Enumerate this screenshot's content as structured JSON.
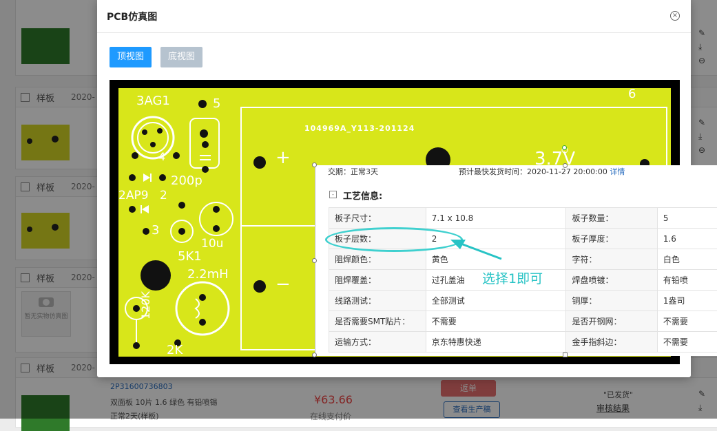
{
  "background": {
    "orders": [
      {
        "label": "样板",
        "date": "2020-"
      },
      {
        "label": "样板",
        "date": "2020-"
      },
      {
        "label": "样板",
        "date": "2020-"
      },
      {
        "label": "样板",
        "date": "2020-"
      }
    ],
    "no_photo_text": "暂无实物仿真图",
    "last_order": {
      "order_no": "2P31600736803",
      "spec": "双面板   10片   1.6   绿色   有铅喷锡",
      "spec2": "正常2天(样板)",
      "price": "¥63.66",
      "payment": "在线支付价",
      "return_label": "返单",
      "production_label": "查看生产稿",
      "ship_status": "\"已发货\"",
      "audit_label": "审核结果"
    },
    "side_icons": [
      "edit-icon",
      "download-icon",
      "more-icon"
    ]
  },
  "modal": {
    "title": "PCB仿真图",
    "close_label": "×",
    "tabs": {
      "top": "顶视图",
      "bottom": "底视图"
    }
  },
  "pcb": {
    "board_id": "104969A_Y113-201124",
    "labels": {
      "fuse": "3AG1",
      "pin5": "5",
      "pin6": "6",
      "pin4": "4",
      "pin3": "3",
      "cap": "200p",
      "diode": "2AP9",
      "pin2": "2",
      "plus": "+",
      "minus": "−",
      "cap2": "10u",
      "res": "5K1",
      "ind": "2.2mH",
      "res2": "120K",
      "res3": "2K",
      "volt": "3.7V"
    }
  },
  "pasted": {
    "delivery": "交期：正常3天",
    "estimate_label": "预计最快发货时间：2020-11-27 20:00:00",
    "estimate_link": "详情",
    "section_toggle": "-",
    "section_title": "工艺信息:",
    "rows": [
      [
        "板子尺寸：",
        "7.1 x 10.8",
        "板子数量：",
        "5"
      ],
      [
        "板子层数：",
        "2",
        "板子厚度：",
        "1.6"
      ],
      [
        "阻焊颜色：",
        "黄色",
        "字符：",
        "白色"
      ],
      [
        "阻焊覆盖：",
        "过孔盖油",
        "焊盘喷镀：",
        "有铅喷"
      ],
      [
        "线路测试：",
        "全部测试",
        "铜厚：",
        "1盎司"
      ],
      [
        "是否需要SMT贴片：",
        "不需要",
        "是否开钢网：",
        "不需要"
      ],
      [
        "运输方式：",
        "京东特惠快递",
        "金手指斜边：",
        "不需要"
      ]
    ]
  },
  "annotation": {
    "text": "选择1即可",
    "color": "#27c3c5"
  }
}
